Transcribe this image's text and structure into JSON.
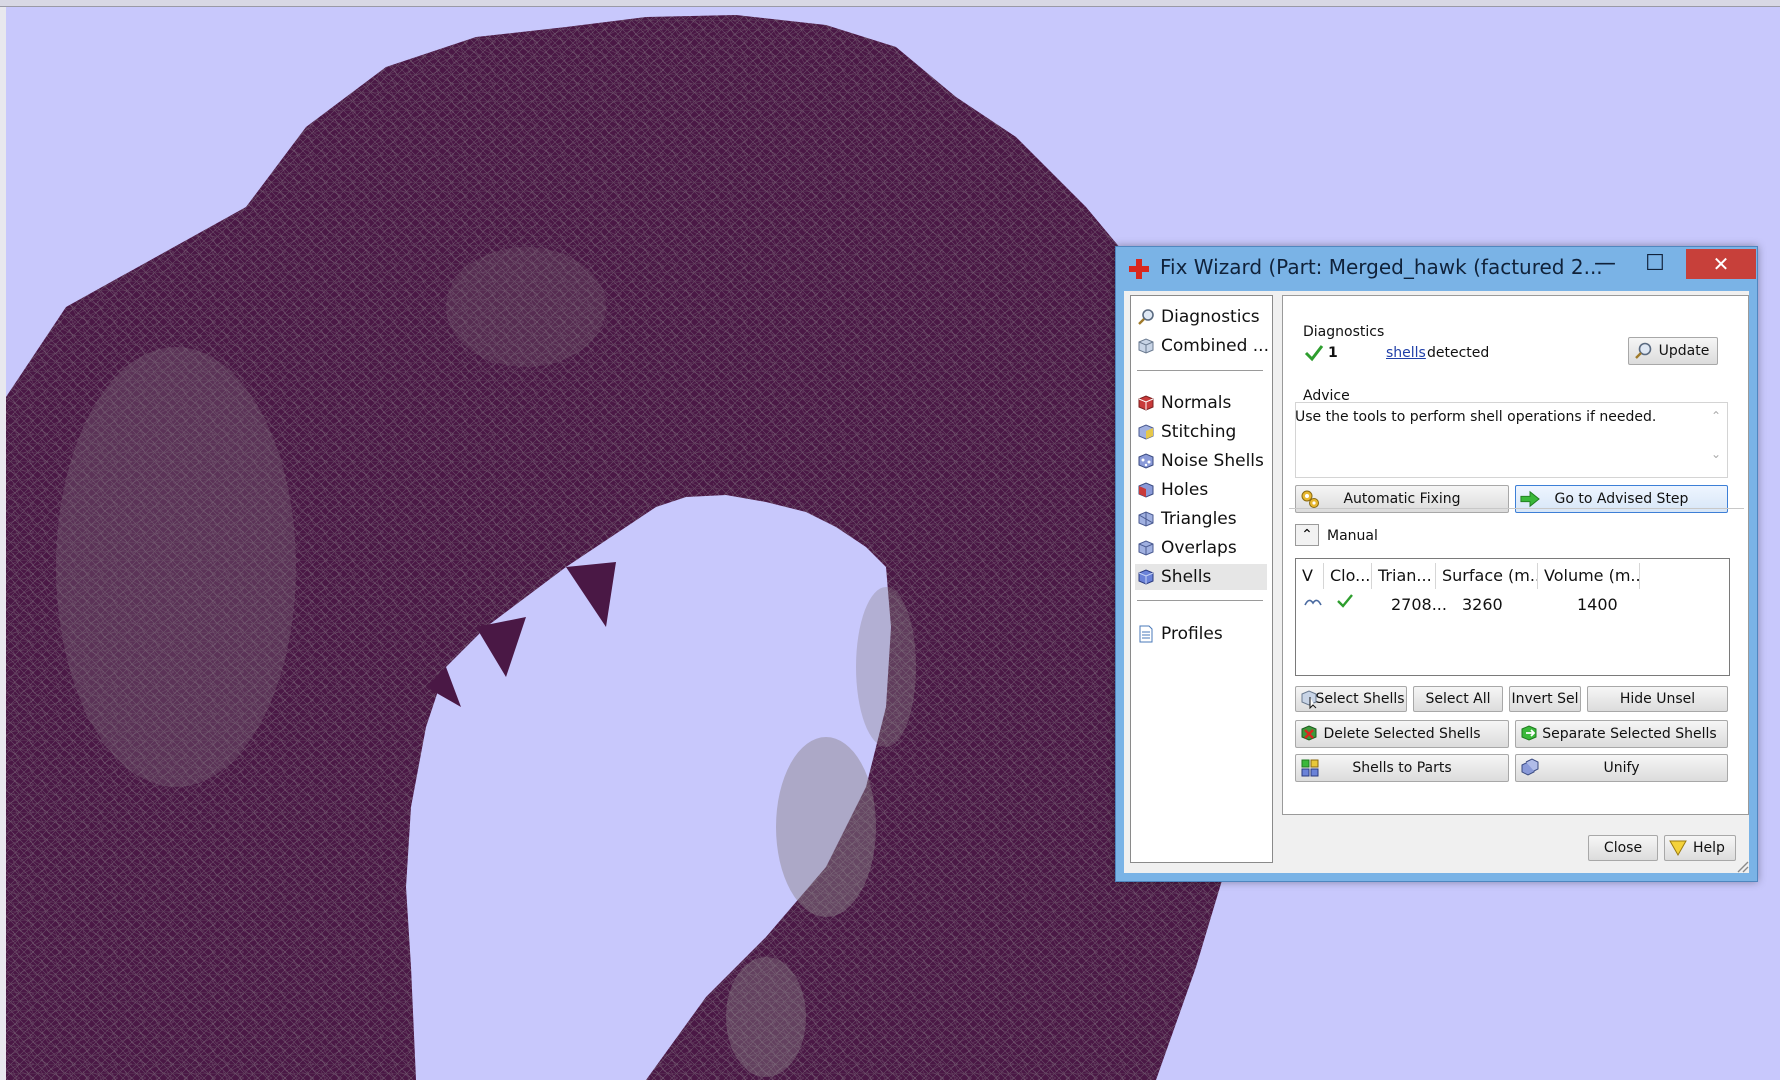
{
  "window": {
    "title": "Fix Wizard (Part: Merged_hawk (factured 2...",
    "min_glyph": "—",
    "max_glyph": "☐",
    "close_glyph": "✕"
  },
  "nav": {
    "items": [
      {
        "label": "Diagnostics",
        "icon": "magnifier-icon"
      },
      {
        "label": "Combined ...",
        "icon": "cube-icon"
      },
      {
        "label": "Normals",
        "icon": "normals-icon"
      },
      {
        "label": "Stitching",
        "icon": "stitching-icon"
      },
      {
        "label": "Noise Shells",
        "icon": "noise-shells-icon"
      },
      {
        "label": "Holes",
        "icon": "holes-icon"
      },
      {
        "label": "Triangles",
        "icon": "triangles-icon"
      },
      {
        "label": "Overlaps",
        "icon": "overlaps-icon"
      },
      {
        "label": "Shells",
        "icon": "shells-icon"
      },
      {
        "label": "Profiles",
        "icon": "document-icon"
      }
    ],
    "selected": "Shells"
  },
  "diagnostics": {
    "heading": "Diagnostics",
    "count": "1",
    "link": "shells",
    "text": "detected",
    "update_label": "Update"
  },
  "advice": {
    "heading": "Advice",
    "text": "Use the tools to perform shell operations if needed."
  },
  "actions": {
    "auto_fix": "Automatic Fixing",
    "advised_step": "Go to Advised Step"
  },
  "manual": {
    "heading": "Manual",
    "collapse_glyph": "⌃",
    "columns": [
      "V",
      "Clo...",
      "Trian...",
      "Surface (m...",
      "Volume (m..."
    ],
    "rows": [
      {
        "triangles": "2708...",
        "surface": "3260",
        "volume": "1400"
      }
    ]
  },
  "buttons": {
    "select_shells": "Select Shells",
    "select_all": "Select All",
    "invert_sel": "Invert Sel",
    "hide_unsel": "Hide Unsel",
    "delete_selected": "Delete Selected Shells",
    "separate_selected": "Separate Selected Shells",
    "shells_to_parts": "Shells to Parts",
    "unify": "Unify",
    "close": "Close",
    "help": "Help"
  },
  "colors": {
    "viewport_bg": "#c8c8fc",
    "mesh": "#4a1845",
    "title_bar": "#7ab3e6",
    "close_button": "#c7403a",
    "check_green": "#2e9e2e",
    "link": "#1f3fa8"
  }
}
